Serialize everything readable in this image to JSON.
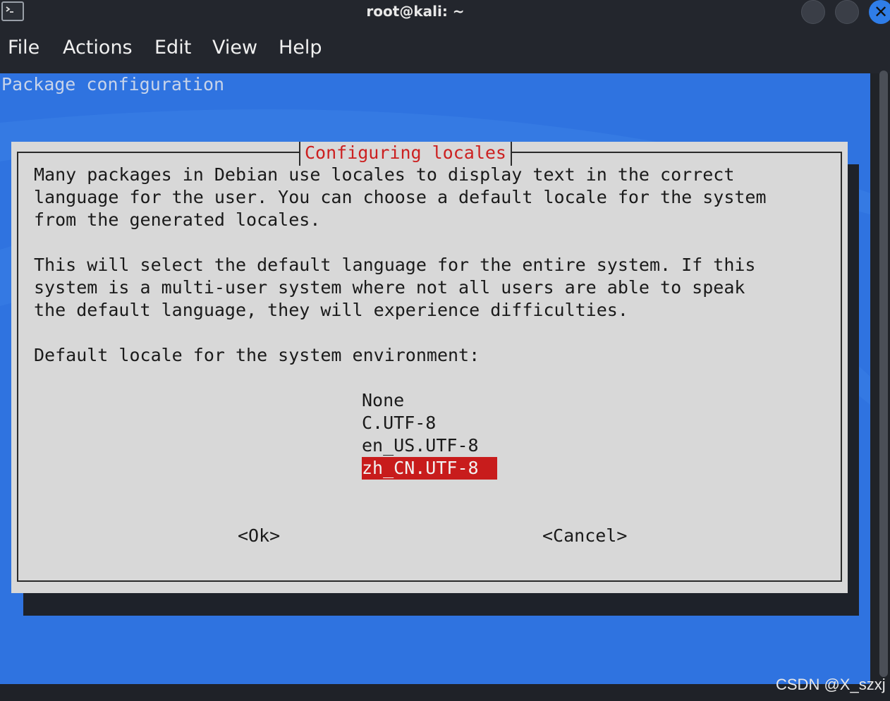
{
  "window": {
    "title": "root@kali: ~"
  },
  "menu": {
    "items": [
      "File",
      "Actions",
      "Edit",
      "View",
      "Help"
    ]
  },
  "terminal": {
    "header": "Package configuration",
    "dialog": {
      "title": "Configuring locales",
      "lines": [
        "Many packages in Debian use locales to display text in the correct",
        "language for the user. You can choose a default locale for the system",
        "from the generated locales.",
        "This will select the default language for the entire system. If this",
        "system is a multi-user system where not all users are able to speak",
        "the default language, they will experience difficulties.",
        "Default locale for the system environment:"
      ],
      "options": [
        "None",
        "C.UTF-8",
        "en_US.UTF-8",
        "zh_CN.UTF-8"
      ],
      "selected_option": "zh_CN.UTF-8",
      "ok_label": "<Ok>",
      "cancel_label": "<Cancel>"
    }
  },
  "watermark": "CSDN @X_szxj",
  "colors": {
    "terminal_bg": "#2f73e0",
    "dialog_bg": "#d8d8d8",
    "dialog_title": "#cc2020",
    "selection_bg": "#c81c1c",
    "close_button": "#2f7de8"
  },
  "icons": [
    "terminal-icon",
    "minimize-icon",
    "maximize-icon",
    "close-icon"
  ]
}
